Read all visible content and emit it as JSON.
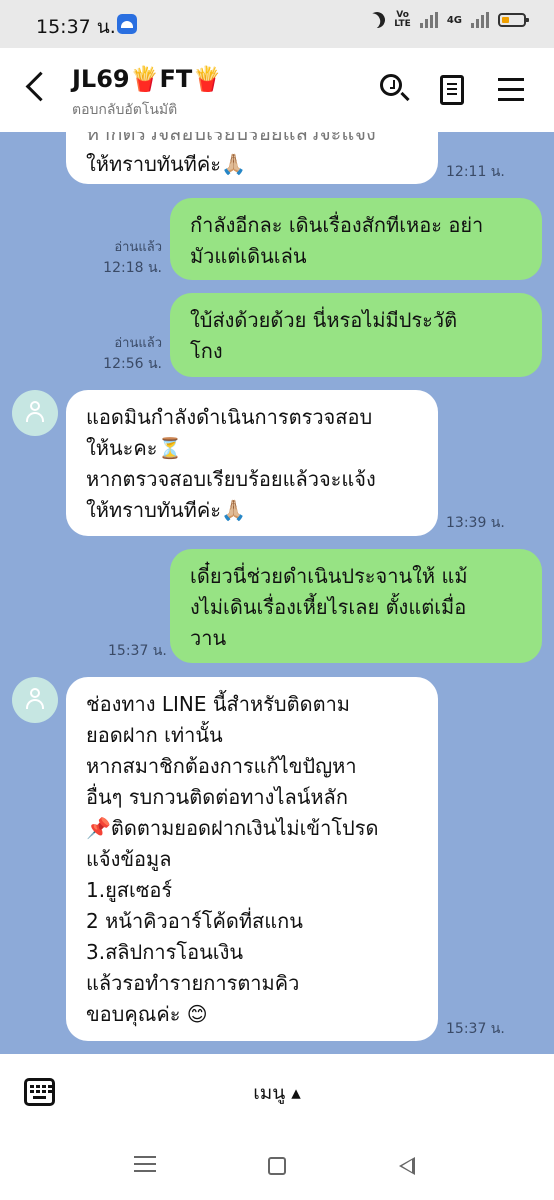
{
  "status_bar": {
    "time": "15:37 น.",
    "network": "4G",
    "volte": "Vo\nLTE"
  },
  "header": {
    "title": "JL69🍟FT🍟",
    "subtitle": "ตอบกลับอัตโนมัติ"
  },
  "messages": [
    {
      "side": "left",
      "lines": [
        "หากตรวจสอบเรียบร้อยแล้วจะแจ้ง",
        "ให้ทราบทันทีค่ะ🙏🏼"
      ],
      "time": "12:11 น."
    },
    {
      "side": "right",
      "lines": [
        "กำลังอีกละ เดินเรื่องสักทีเหอะ อย่า",
        "มัวแต่เดินเล่น"
      ],
      "read": "อ่านแล้ว",
      "time": "12:18 น."
    },
    {
      "side": "right",
      "lines": [
        "ใบ้ส่งด้วยด้วย นี่หรอไม่มีประวัติ",
        "โกง"
      ],
      "read": "อ่านแล้ว",
      "time": "12:56 น."
    },
    {
      "side": "left",
      "lines": [
        "แอดมินกำลังดำเนินการตรวจสอบ",
        "ให้นะคะ⏳",
        "หากตรวจสอบเรียบร้อยแล้วจะแจ้ง",
        "ให้ทราบทันทีค่ะ🙏🏼"
      ],
      "time": "13:39 น."
    },
    {
      "side": "right",
      "lines": [
        "เดี๋ยวนี่ช่วยดำเนินประจานให้ แม้",
        "งไม่เดินเรื่องเหี้ยไรเลย ตั้งแต่เมื่อ",
        "วาน"
      ],
      "time": "15:37 น."
    },
    {
      "side": "left",
      "lines": [
        "ช่องทาง LINE นี้สำหรับติดตาม",
        "ยอดฝาก เท่านั้น",
        "หากสมาชิกต้องการแก้ไขปัญหา",
        "อื่นๆ รบกวนติดต่อทางไลน์หลัก",
        "📌ติดตามยอดฝากเงินไม่เข้าโปรด",
        "แจ้งข้อมูล",
        "1.ยูสเซอร์",
        "2 หน้าคิวอาร์โค้ดที่สแกน",
        "3.สลิปการโอนเงิน",
        "แล้วรอทำรายการตามคิว",
        "ขอบคุณค่ะ 😊"
      ],
      "time": "15:37 น."
    }
  ],
  "input_bar": {
    "menu_label": "เมนู ▴"
  }
}
